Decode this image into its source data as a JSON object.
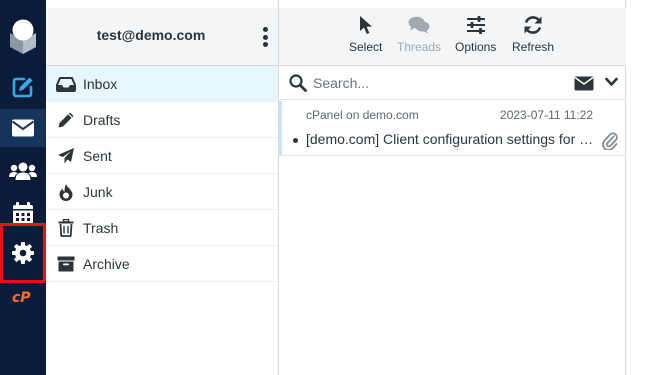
{
  "taskbar": {
    "items": [
      {
        "name": "compose",
        "icon": "compose-icon"
      },
      {
        "name": "mail",
        "icon": "envelope-icon",
        "active": true
      },
      {
        "name": "contacts",
        "icon": "users-icon"
      },
      {
        "name": "calendar",
        "icon": "calendar-icon"
      },
      {
        "name": "settings",
        "icon": "gear-icon",
        "highlighted": true
      },
      {
        "name": "cpanel",
        "icon": "cpanel-logo-icon"
      }
    ],
    "colors": {
      "background": "#0b1c3a",
      "active": "#16335c",
      "icon": "#ffffff",
      "compose": "#37a9e8",
      "highlight": "#e3121b",
      "cpanel": "#ff6c2c"
    }
  },
  "account": {
    "email": "test@demo.com",
    "menu_icon": "kebab-menu-icon"
  },
  "folders": [
    {
      "label": "Inbox",
      "icon": "inbox-icon",
      "selected": true
    },
    {
      "label": "Drafts",
      "icon": "pencil-icon"
    },
    {
      "label": "Sent",
      "icon": "paper-plane-icon"
    },
    {
      "label": "Junk",
      "icon": "fire-icon"
    },
    {
      "label": "Trash",
      "icon": "trash-icon"
    },
    {
      "label": "Archive",
      "icon": "archive-box-icon"
    }
  ],
  "toolbar": {
    "select_label": "Select",
    "threads_label": "Threads",
    "options_label": "Options",
    "refresh_label": "Refresh"
  },
  "search": {
    "placeholder": "Search...",
    "value": ""
  },
  "messages": [
    {
      "from": "cPanel on demo.com",
      "date": "2023-07-11 11:22",
      "subject": "[demo.com] Client configuration settings for “test@demo.com”.",
      "unread": true,
      "has_attachment": true
    }
  ]
}
